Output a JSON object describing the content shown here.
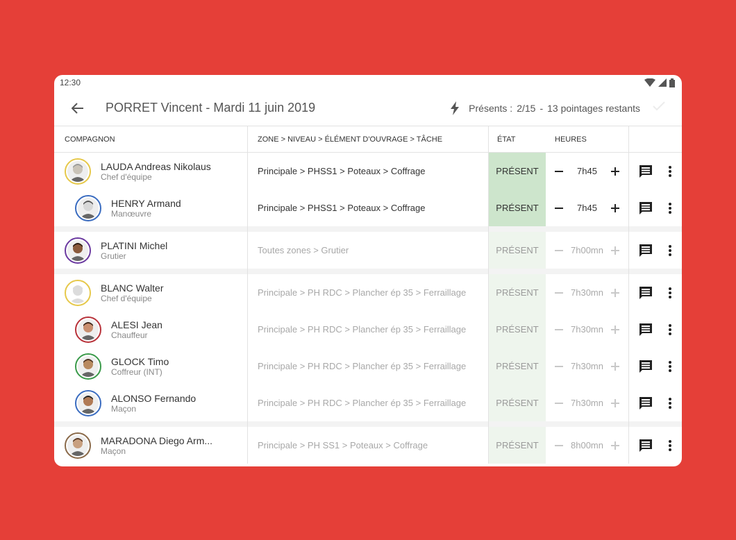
{
  "status_bar": {
    "time": "12:30"
  },
  "app_bar": {
    "title": "PORRET Vincent - Mardi 11 juin 2019",
    "presence_label": "Présents :",
    "presence_value": "2/15",
    "separator": "-",
    "remaining": "13 pointages restants"
  },
  "columns": {
    "name": "COMPAGNON",
    "zone": "ZONE > NIVEAU > ÉLÉMENT D'OUVRAGE > TÂCHE",
    "etat": "ÉTAT",
    "hours": "HEURES"
  },
  "groups": [
    {
      "rows": [
        {
          "name": "LAUDA Andreas Nikolaus",
          "role": "Chef d'équipe",
          "zone": "Principale > PHSS1 > Poteaux > Coffrage",
          "etat": "PRÉSENT",
          "hours": "7h45",
          "lead": true,
          "active": true,
          "ring": "#e6c84a",
          "skin": "#c9c3b8",
          "hair": "#9a9a9a"
        },
        {
          "name": "HENRY Armand",
          "role": "Manœuvre",
          "zone": "Principale > PHSS1 > Poteaux > Coffrage",
          "etat": "PRÉSENT",
          "hours": "7h45",
          "lead": false,
          "active": true,
          "ring": "#3a6cc0",
          "skin": "#d8d8d8",
          "hair": "#555555"
        }
      ]
    },
    {
      "rows": [
        {
          "name": "PLATINI Michel",
          "role": "Grutier",
          "zone": "Toutes zones > Grutier",
          "etat": "PRÉSENT",
          "hours": "7h00mn",
          "lead": true,
          "active": false,
          "ring": "#6b3aa0",
          "skin": "#8a5a3c",
          "hair": "#2a1a10"
        }
      ]
    },
    {
      "rows": [
        {
          "name": "BLANC Walter",
          "role": "Chef d'équipe",
          "zone": "Principale > PH RDC > Plancher ép 35 > Ferraillage",
          "etat": "PRÉSENT",
          "hours": "7h30mn",
          "lead": true,
          "active": false,
          "ring": "#e6c84a",
          "skin": "#dcdcdc",
          "hair": "#dcdcdc"
        },
        {
          "name": "ALESI Jean",
          "role": "Chauffeur",
          "zone": "Principale > PH RDC > Plancher ép 35 > Ferraillage",
          "etat": "PRÉSENT",
          "hours": "7h30mn",
          "lead": false,
          "active": false,
          "ring": "#b8323a",
          "skin": "#c98f70",
          "hair": "#3a2418"
        },
        {
          "name": "GLOCK Timo",
          "role": "Coffreur (INT)",
          "zone": "Principale > PH RDC > Plancher ép 35 > Ferraillage",
          "etat": "PRÉSENT",
          "hours": "7h30mn",
          "lead": false,
          "active": false,
          "ring": "#3a9a4a",
          "skin": "#b88a60",
          "hair": "#4a3020"
        },
        {
          "name": "ALONSO Fernando",
          "role": "Maçon",
          "zone": "Principale > PH RDC > Plancher ép 35 > Ferraillage",
          "etat": "PRÉSENT",
          "hours": "7h30mn",
          "lead": false,
          "active": false,
          "ring": "#3a6cc0",
          "skin": "#b07a55",
          "hair": "#222222"
        }
      ]
    },
    {
      "rows": [
        {
          "name": "MARADONA Diego Arm...",
          "role": "Maçon",
          "zone": "Principale > PH SS1 > Poteaux > Coffrage",
          "etat": "PRÉSENT",
          "hours": "8h00mn",
          "lead": true,
          "active": false,
          "ring": "#8a6a4a",
          "skin": "#c8a080",
          "hair": "#5a3a24"
        }
      ]
    }
  ],
  "icons": {
    "back": "arrow-left-icon",
    "bolt": "lightning-icon",
    "check": "check-icon",
    "comment": "comment-icon",
    "more": "more-vert-icon",
    "minus": "minus-icon",
    "plus": "plus-icon"
  }
}
